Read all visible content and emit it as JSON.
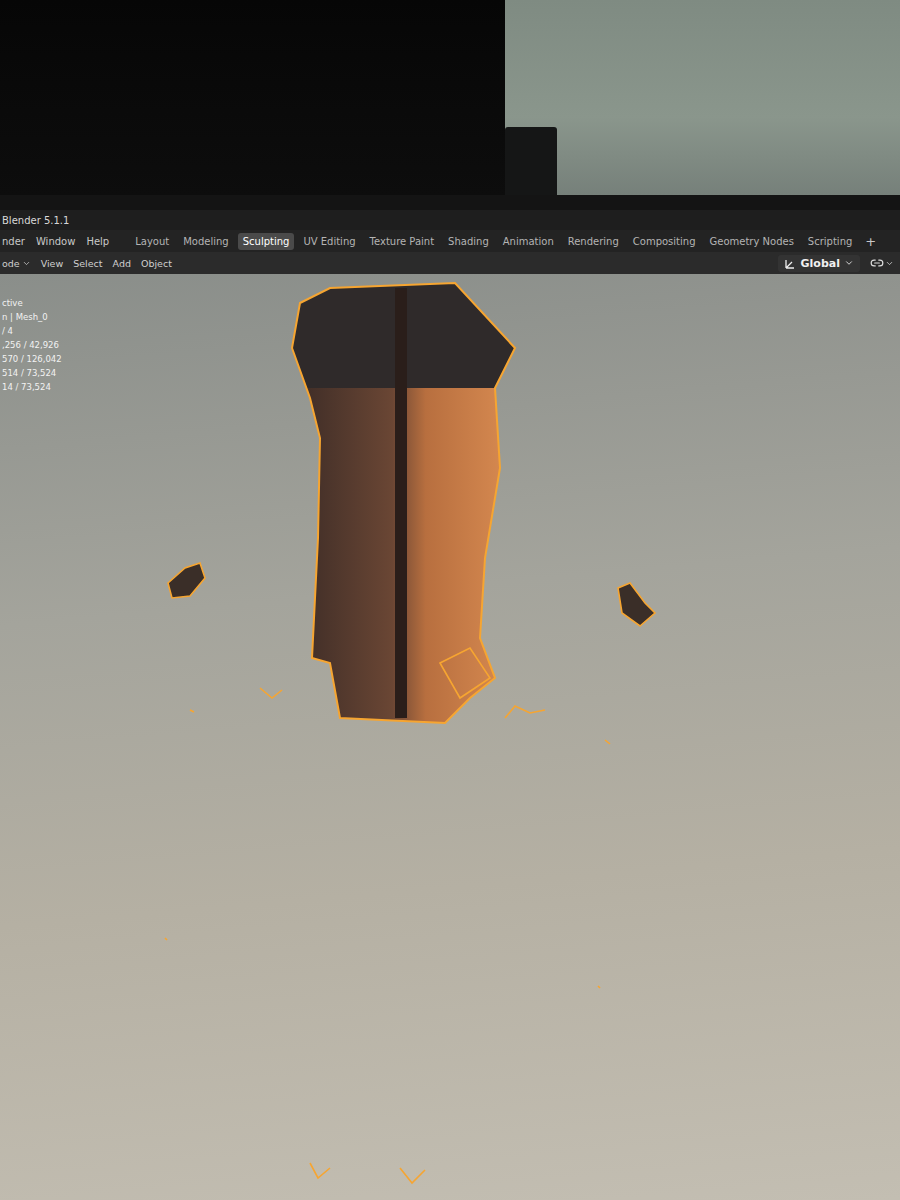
{
  "window": {
    "title": "Blender 5.1.1"
  },
  "menu": [
    "nder",
    "Window",
    "Help"
  ],
  "workspaces": [
    {
      "label": "Layout",
      "selected": false
    },
    {
      "label": "Modeling",
      "selected": false
    },
    {
      "label": "Sculpting",
      "selected": true
    },
    {
      "label": "UV Editing",
      "selected": false
    },
    {
      "label": "Texture Paint",
      "selected": false
    },
    {
      "label": "Shading",
      "selected": false
    },
    {
      "label": "Animation",
      "selected": false
    },
    {
      "label": "Rendering",
      "selected": false
    },
    {
      "label": "Compositing",
      "selected": false
    },
    {
      "label": "Geometry Nodes",
      "selected": false
    },
    {
      "label": "Scripting",
      "selected": false
    }
  ],
  "add_workspace": "+",
  "header": {
    "mode": "ode",
    "items": [
      "View",
      "Select",
      "Add",
      "Object"
    ],
    "orientation": "Global"
  },
  "stats": [
    "ctive",
    "n | Mesh_0",
    "/ 4",
    ",256 / 42,926",
    "570 / 126,042",
    "514 / 73,524",
    "14 / 73,524"
  ]
}
